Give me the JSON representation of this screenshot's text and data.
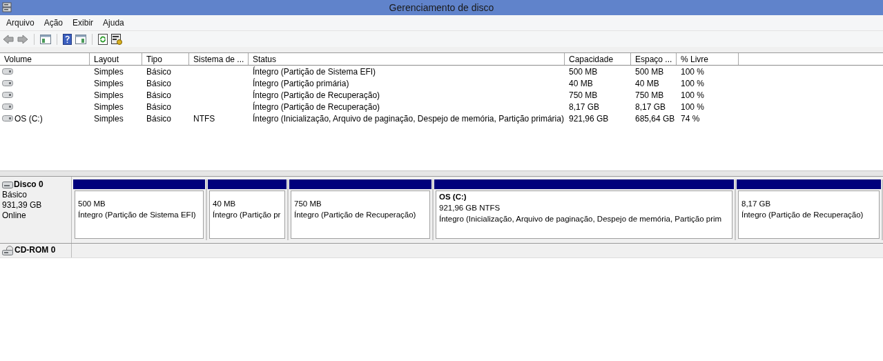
{
  "window": {
    "title": "Gerenciamento de disco"
  },
  "menu": [
    "Arquivo",
    "Ação",
    "Exibir",
    "Ajuda"
  ],
  "volume_table": {
    "columns": [
      "Volume",
      "Layout",
      "Tipo",
      "Sistema de ...",
      "Status",
      "Capacidade",
      "Espaço ...",
      "% Livre"
    ],
    "rows": [
      {
        "layout": "Simples",
        "type": "Básico",
        "status": "Íntegro (Partição de Sistema EFI)",
        "capacity": "500 MB",
        "free_space": "500 MB",
        "percent_free": "100 %"
      },
      {
        "layout": "Simples",
        "type": "Básico",
        "status": "Íntegro (Partição primária)",
        "capacity": "40 MB",
        "free_space": "40 MB",
        "percent_free": "100 %"
      },
      {
        "layout": "Simples",
        "type": "Básico",
        "status": "Íntegro (Partição de Recuperação)",
        "capacity": "750 MB",
        "free_space": "750 MB",
        "percent_free": "100 %"
      },
      {
        "layout": "Simples",
        "type": "Básico",
        "status": "Íntegro (Partição de Recuperação)",
        "capacity": "8,17 GB",
        "free_space": "8,17 GB",
        "percent_free": "100 %"
      },
      {
        "volume": "OS (C:)",
        "layout": "Simples",
        "type": "Básico",
        "file_system": "NTFS",
        "status": "Íntegro (Inicialização, Arquivo de paginação, Despejo de memória, Partição primária)",
        "capacity": "921,96 GB",
        "free_space": "685,64 GB",
        "percent_free": "74 %"
      }
    ]
  },
  "disks": [
    {
      "kind": "disk",
      "name": "Disco 0",
      "type": "Básico",
      "size": "931,39 GB",
      "status": "Online",
      "partitions": [
        {
          "size": "500 MB",
          "status": "Íntegro (Partição de Sistema EFI)"
        },
        {
          "size": "40 MB",
          "status": "Íntegro (Partição pr"
        },
        {
          "size": "750 MB",
          "status": "Íntegro (Partição de Recuperação)"
        },
        {
          "name": "OS  (C:)",
          "size": "921,96 GB NTFS",
          "status": "Íntegro (Inicialização, Arquivo de paginação, Despejo de memória, Partição prim"
        },
        {
          "size": "8,17 GB",
          "status": "Íntegro (Partição de Recuperação)"
        }
      ]
    },
    {
      "kind": "cdrom",
      "name": "CD-ROM 0"
    }
  ]
}
